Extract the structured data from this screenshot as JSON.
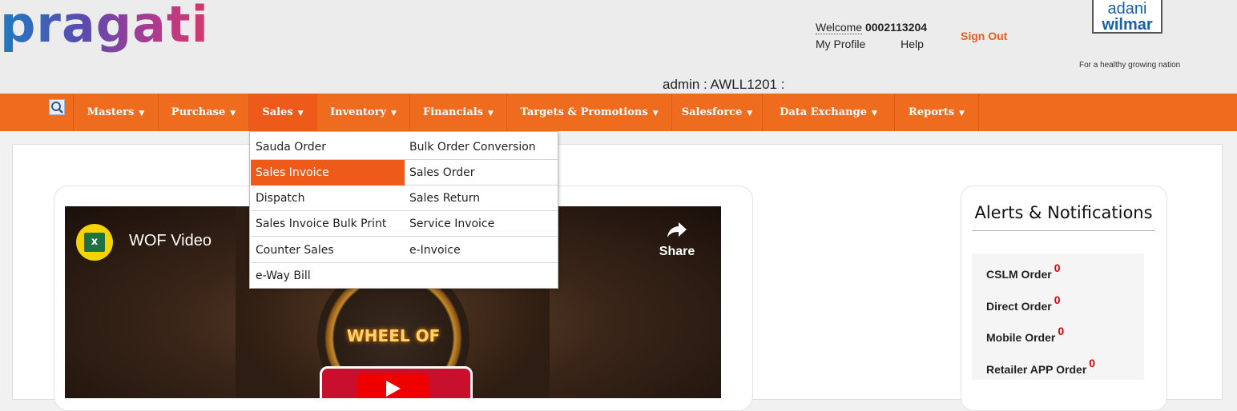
{
  "header": {
    "logo": "pragati",
    "welcome_label": "Welcome",
    "user_id": "0002113204",
    "my_profile": "My Profile",
    "help": "Help",
    "sign_out": "Sign Out",
    "brand_line1": "adani",
    "brand_line2": "wilmar",
    "tagline": "For a healthy growing nation",
    "admin_text": "admin : AWLL1201 :"
  },
  "nav": {
    "search_icon": "search-icon",
    "items": [
      {
        "label": "Masters",
        "active": false
      },
      {
        "label": "Purchase",
        "active": false
      },
      {
        "label": "Sales",
        "active": true
      },
      {
        "label": "Inventory",
        "active": false
      },
      {
        "label": "Financials",
        "active": false
      },
      {
        "label": "Targets & Promotions",
        "active": false
      },
      {
        "label": "Salesforce",
        "active": false
      },
      {
        "label": "Data Exchange",
        "active": false
      },
      {
        "label": "Reports",
        "active": false
      }
    ],
    "caret": "▼"
  },
  "sales_menu": {
    "col1": [
      "Sauda Order",
      "Sales Invoice",
      "Dispatch",
      "Sales Invoice Bulk Print",
      "Counter Sales",
      "e-Way Bill"
    ],
    "col2": [
      "Bulk Order Conversion",
      "Sales Order",
      "Sales Return",
      "Service Invoice",
      "e-Invoice"
    ],
    "highlighted": "Sales Invoice"
  },
  "video": {
    "title": "WOF Video",
    "share_label": "Share",
    "channel_icon": "excel-icon",
    "thumb_text": "WHEEL OF"
  },
  "alerts": {
    "title": "Alerts & Notifications",
    "items": [
      {
        "label": "CSLM Order",
        "count": "0"
      },
      {
        "label": "Direct Order",
        "count": "0"
      },
      {
        "label": "Mobile Order",
        "count": "0"
      },
      {
        "label": "Retailer APP Order",
        "count": "0"
      }
    ]
  },
  "colors": {
    "nav_bg": "#ef6c1e",
    "highlight": "#ee5a1a",
    "count_red": "#e20000"
  }
}
